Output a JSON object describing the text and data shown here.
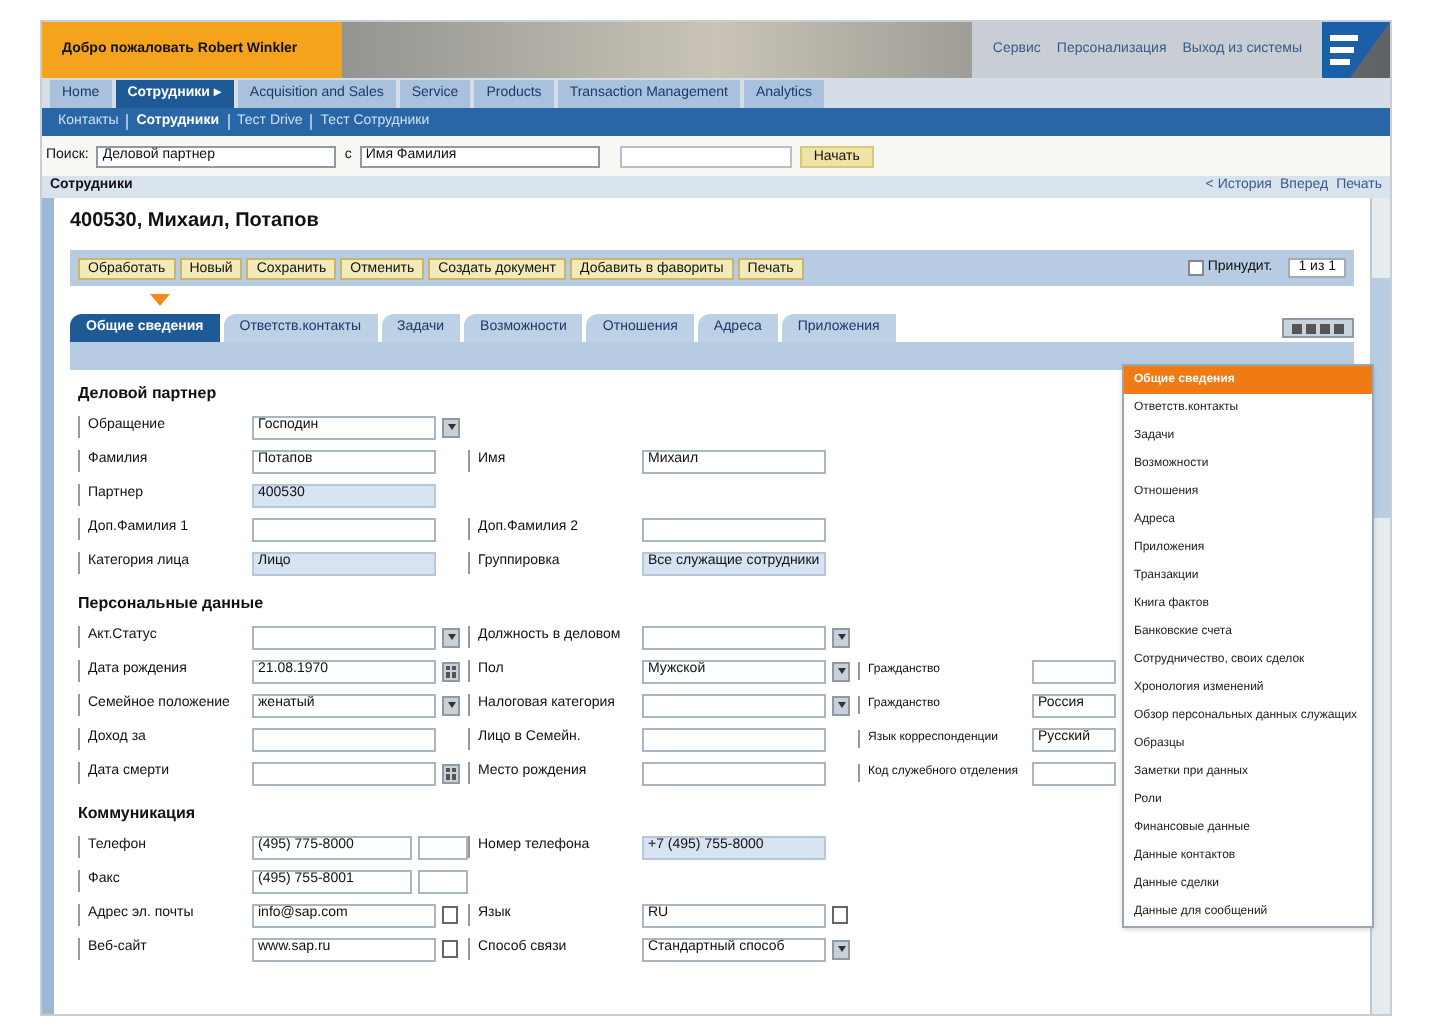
{
  "header": {
    "welcome": "Добро пожаловать Robert Winkler",
    "links": [
      "Сервис",
      "Персонализация",
      "Выход из системы"
    ]
  },
  "nav": [
    {
      "label": "Home",
      "selected": false
    },
    {
      "label": "Сотрудники ▸",
      "selected": true
    },
    {
      "label": "Acquisition and Sales",
      "selected": false
    },
    {
      "label": "Service",
      "selected": false
    },
    {
      "label": "Products",
      "selected": false
    },
    {
      "label": "Transaction Management",
      "selected": false
    },
    {
      "label": "Analytics",
      "selected": false
    }
  ],
  "subnav": [
    {
      "label": "Контакты",
      "selected": false
    },
    {
      "label": "Сотрудники",
      "selected": true
    },
    {
      "label": "Тест Drive",
      "selected": false
    },
    {
      "label": "Тест Сотрудники",
      "selected": false
    }
  ],
  "search": {
    "label": "Поиск:",
    "object": "Деловой партнер",
    "connector": "с",
    "criterion": "Имя Фамилия",
    "button": "Начать"
  },
  "page_bar": {
    "title": "Сотрудники",
    "links": [
      "< История",
      "Вперед",
      "Печать"
    ]
  },
  "record": {
    "title": "400530, Михаил, Потапов",
    "toolbar": [
      "Обработать",
      "Новый",
      "Сохранить",
      "Отменить",
      "Создать документ",
      "Добавить в фавориты",
      "Печать"
    ],
    "check": {
      "label": "Принудит.",
      "checked": false
    },
    "pager": "1 из 1"
  },
  "tabs": [
    {
      "label": "Общие сведения",
      "selected": true
    },
    {
      "label": "Ответств.контакты",
      "selected": false
    },
    {
      "label": "Задачи",
      "selected": false
    },
    {
      "label": "Возможности",
      "selected": false
    },
    {
      "label": "Отношения",
      "selected": false
    },
    {
      "label": "Адреса",
      "selected": false
    },
    {
      "label": "Приложения",
      "selected": false
    }
  ],
  "sections": [
    {
      "title": "Деловой партнер",
      "rows": [
        [
          {
            "label": "Обращение",
            "value": "Господин",
            "kind": "dropdown"
          }
        ],
        [
          {
            "label": "Фамилия",
            "value": "Потапов",
            "kind": "text"
          },
          {
            "label": "Имя",
            "value": "Михаил",
            "kind": "text"
          }
        ],
        [
          {
            "label": "Партнер",
            "value": "400530",
            "kind": "readonly"
          }
        ],
        [
          {
            "label": "Доп.Фамилия 1",
            "kind": "text"
          },
          {
            "label": "Доп.Фамилия 2",
            "kind": "text"
          }
        ],
        [
          {
            "label": "Категория лица",
            "value": "Лицо",
            "kind": "readonly"
          },
          {
            "label": "Группировка",
            "value": "Все служащие сотрудники",
            "kind": "readonly"
          }
        ]
      ]
    },
    {
      "title": "Персональные данные",
      "rows": [
        [
          {
            "label": "Акт.Статус",
            "kind": "dropdown"
          },
          {
            "label": "Должность в деловом",
            "kind": "dropdown"
          }
        ],
        [
          {
            "label": "Дата рождения",
            "value": "21.08.1970",
            "kind": "date"
          },
          {
            "label": "Пол",
            "value": "Мужской",
            "kind": "dropdown"
          },
          {
            "label": "Гражданство",
            "kind": "text"
          }
        ],
        [
          {
            "label": "Семейное положение",
            "value": "женатый",
            "kind": "dropdown"
          },
          {
            "label": "Налоговая категория",
            "kind": "dropdown"
          },
          {
            "label": "Гражданство",
            "value": "Россия",
            "kind": "text"
          }
        ],
        [
          {
            "label": "Доход за",
            "kind": "text"
          },
          {
            "label": "Лицо в Семейн.",
            "kind": "text"
          },
          {
            "label": "Язык корреспонденции",
            "value": "Русский",
            "kind": "text"
          }
        ],
        [
          {
            "label": "Дата смерти",
            "kind": "date"
          },
          {
            "label": "Место рождения",
            "kind": "text"
          },
          {
            "label": "Код служебного отделения",
            "kind": "text"
          }
        ]
      ]
    },
    {
      "title": "Коммуникация",
      "rows": [
        [
          {
            "label": "Телефон",
            "value": "(495) 775-8000",
            "kind": "phone"
          },
          {
            "label": "Номер телефона",
            "value": "+7 (495) 755-8000",
            "kind": "readonly"
          }
        ],
        [
          {
            "label": "Факс",
            "value": "(495) 755-8001",
            "kind": "phone"
          }
        ],
        [
          {
            "label": "Адрес эл. почты",
            "value": "info@sap.com",
            "kind": "picker"
          },
          {
            "label": "Язык",
            "value": "RU",
            "kind": "picker"
          }
        ],
        [
          {
            "label": "Веб-сайт",
            "value": "www.sap.ru",
            "kind": "picker"
          },
          {
            "label": "Способ связи",
            "value": "Стандартный способ",
            "kind": "dropdown"
          }
        ]
      ]
    }
  ],
  "menu": [
    {
      "label": "Общие сведения",
      "selected": true
    },
    {
      "label": "Ответств.контакты",
      "selected": false
    },
    {
      "label": "Задачи",
      "selected": false
    },
    {
      "label": "Возможности",
      "selected": false
    },
    {
      "label": "Отношения",
      "selected": false
    },
    {
      "label": "Адреса",
      "selected": false
    },
    {
      "label": "Приложения",
      "selected": false
    },
    {
      "label": "Транзакции",
      "selected": false
    },
    {
      "label": "Книга фактов",
      "selected": false
    },
    {
      "label": "Банковские счета",
      "selected": false
    },
    {
      "label": "Сотрудничество, своих сделок",
      "selected": false
    },
    {
      "label": "Хронология изменений",
      "selected": false
    },
    {
      "label": "Обзор персональных данных служащих",
      "selected": false
    },
    {
      "label": "Образцы",
      "selected": false
    },
    {
      "label": "Заметки при данных",
      "selected": false
    },
    {
      "label": "Роли",
      "selected": false
    },
    {
      "label": "Финансовые данные",
      "selected": false
    },
    {
      "label": "Данные контактов",
      "selected": false
    },
    {
      "label": "Данные сделки",
      "selected": false
    },
    {
      "label": "Данные для сообщений",
      "selected": false
    }
  ]
}
